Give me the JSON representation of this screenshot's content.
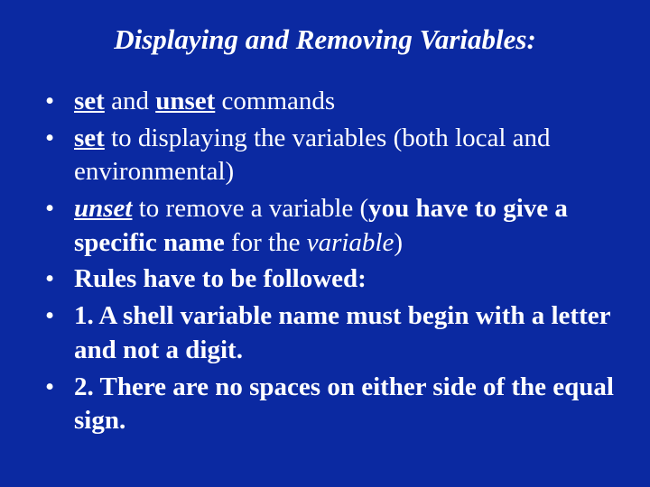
{
  "title": "Displaying and Removing Variables:",
  "items": {
    "i0": {
      "set": "set",
      "and": " and ",
      "unset": "unset",
      "rest": " commands"
    },
    "i1": {
      "set": "set",
      "rest": " to displaying the variables (both local and environmental)"
    },
    "i2": {
      "unset": "unset",
      "mid": " to remove a variable (",
      "bold": "you have to give a specific name",
      "for": " for the ",
      "var": "variable",
      "close": ")"
    },
    "i3": {
      "text": "Rules have to be followed:"
    },
    "i4": {
      "text": "1. A shell variable name must begin with a letter and not a digit."
    },
    "i5": {
      "text": "2. There are no spaces on either side of the equal sign."
    }
  }
}
